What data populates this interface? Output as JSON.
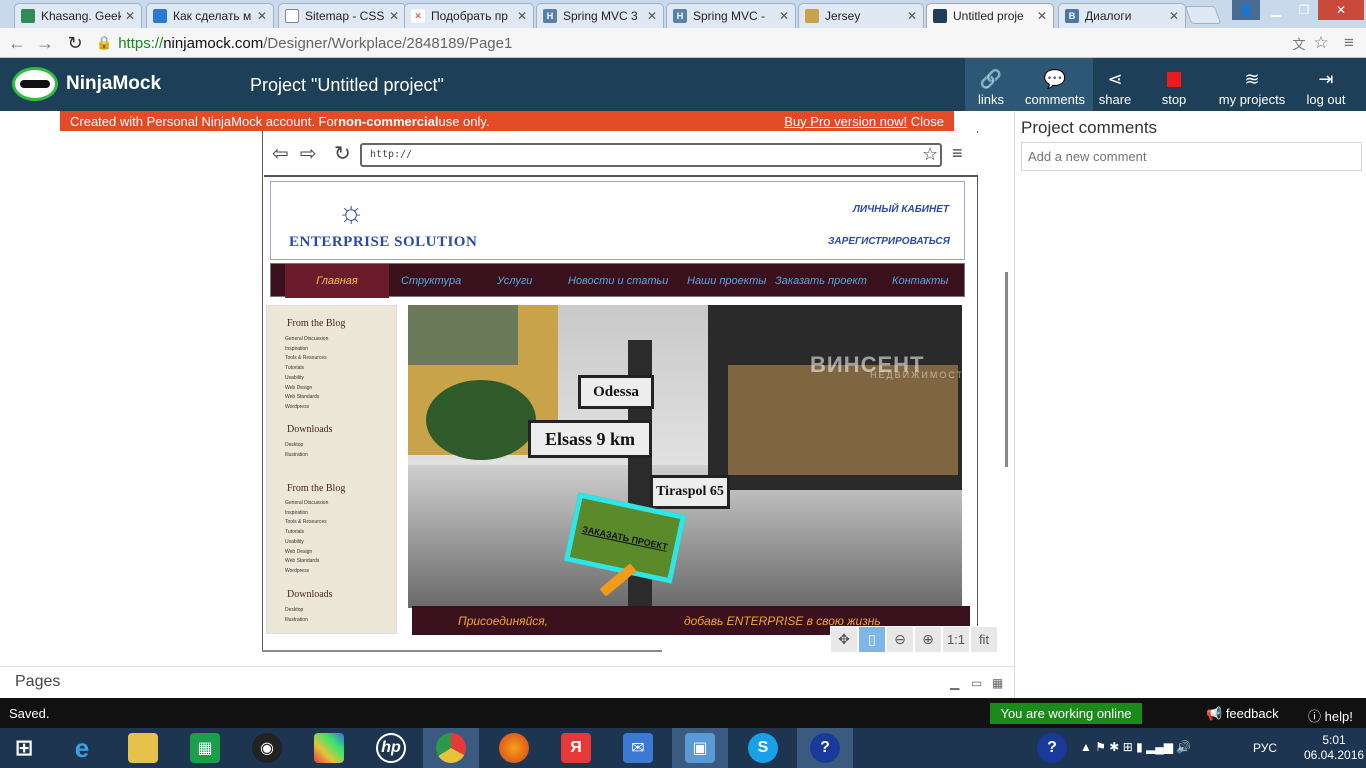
{
  "browser": {
    "tabs": [
      {
        "title": "Khasang. Geek",
        "icon_color": "#2e8b57"
      },
      {
        "title": "Как сделать м",
        "icon_color": "#2a7ad4"
      },
      {
        "title": "Sitemap - CSS",
        "icon_color": "#888888"
      },
      {
        "title": "Подобрать пр",
        "icon_color": "#d43a2a"
      },
      {
        "title": "Spring MVC 3",
        "icon_color": "#5a7fa8"
      },
      {
        "title": "Spring MVC -",
        "icon_color": "#5a7fa8"
      },
      {
        "title": "Jersey",
        "icon_color": "#c9a34a"
      },
      {
        "title": "Untitled proje",
        "icon_color": "#1d4058"
      },
      {
        "title": "Диалоги",
        "icon_color": "#4a76a8"
      }
    ],
    "url_scheme": "https://",
    "url_host": "ninjamock.com",
    "url_path": "/Designer/Workplace/2848189/Page1"
  },
  "app": {
    "logo_text": "NinjaMock",
    "project_title": "Project \"Untitled project\"",
    "toolbar": {
      "links": "links",
      "comments": "comments",
      "share": "share",
      "stop": "stop",
      "my_projects": "my projects",
      "log_out": "log out"
    },
    "banner": {
      "text_before": "Created with Personal NinjaMock account. For ",
      "text_bold": "non-commercial",
      "text_after": " use only.",
      "buy_pro": "Buy Pro version now!",
      "close": "Close"
    }
  },
  "mockup": {
    "address": "http://",
    "site_title": "ENTERPRISE SOLUTION",
    "link_cabinet": "ЛИЧНЫЙ КАБИНЕТ",
    "link_register": "ЗАРЕГИСТРИРОВАТЬСЯ",
    "nav": [
      "Главная",
      "Структура",
      "Услуги",
      "Новости и статьи",
      "Наши проекты",
      "Заказать проект",
      "Контакты"
    ],
    "sidebar": {
      "blog_heading": "From the Blog",
      "blog_items": [
        "General Discussion",
        "Inspiration",
        "Tools & Resources",
        "Tutorials",
        "Usability",
        "Web Design",
        "Web Standards",
        "Wordpress"
      ],
      "downloads_heading": "Downloads",
      "download_items": [
        "Desktop",
        "Illustration"
      ]
    },
    "hero": {
      "sign_odessa": "Odessa",
      "sign_elsass": "Elsass 9 km",
      "sign_tiraspol": "Tiraspol 65",
      "watermark": "ВИНСЕНТ",
      "watermark_sub": "НЕДВИЖИМОСТЬ",
      "promo_button": "ЗАКАЗАТЬ ПРОЕКТ"
    },
    "tagline_left": "Присоединяйся,",
    "tagline_right": "добавь ENTERPRISE в свою жизнь"
  },
  "zoom": {
    "one_to_one": "1:1",
    "fit": "fit"
  },
  "pages": {
    "label": "Pages"
  },
  "comments_panel": {
    "title": "Project comments",
    "placeholder": "Add a new comment"
  },
  "status": {
    "saved": "Saved.",
    "online": "You are working online",
    "feedback": "feedback",
    "help": "help!"
  },
  "taskbar": {
    "lang": "РУС",
    "time": "5:01",
    "date": "06.04.2016"
  }
}
